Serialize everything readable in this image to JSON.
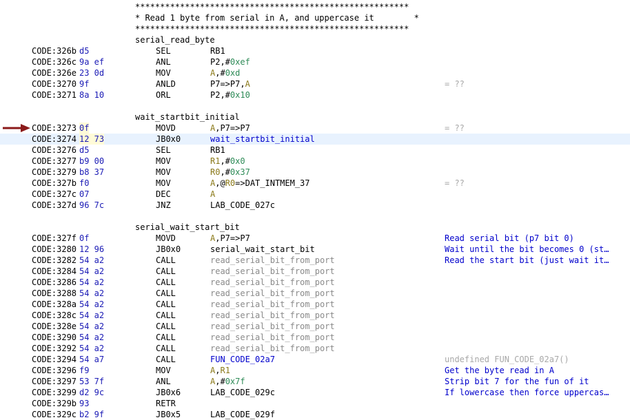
{
  "banner": [
    "*******************************************************",
    "* Read 1 byte from serial in A, and uppercase it        *",
    "*******************************************************"
  ],
  "label_serial_read_byte": "serial_read_byte",
  "label_wait_startbit_initial": "wait_startbit_initial",
  "label_serial_wait_start_bit": "serial_wait_start_bit",
  "block1": [
    {
      "addr": "CODE:326b",
      "bytes": "d5",
      "mnem": "SEL",
      "ops": [
        {
          "t": "RB1",
          "k": "plain"
        }
      ],
      "comment": ""
    },
    {
      "addr": "CODE:326c",
      "bytes": "9a ef",
      "mnem": "ANL",
      "ops": [
        {
          "t": "P2,#",
          "k": "plain"
        },
        {
          "t": "0xef",
          "k": "imm"
        }
      ],
      "comment": ""
    },
    {
      "addr": "CODE:326e",
      "bytes": "23 0d",
      "mnem": "MOV",
      "ops": [
        {
          "t": "A",
          "k": "reg"
        },
        {
          "t": ",#",
          "k": "plain"
        },
        {
          "t": "0xd",
          "k": "imm"
        }
      ],
      "comment": ""
    },
    {
      "addr": "CODE:3270",
      "bytes": "9f",
      "mnem": "ANLD",
      "ops": [
        {
          "t": "P7=>P7,",
          "k": "plain"
        },
        {
          "t": "A",
          "k": "reg"
        }
      ],
      "comment": "= ??",
      "ctype": "gray"
    },
    {
      "addr": "CODE:3271",
      "bytes": "8a 10",
      "mnem": "ORL",
      "ops": [
        {
          "t": "P2,#",
          "k": "plain"
        },
        {
          "t": "0x10",
          "k": "imm"
        }
      ],
      "comment": ""
    }
  ],
  "block2": [
    {
      "addr": "CODE:3273",
      "bytes": "0f",
      "mnem": "MOVD",
      "ops": [
        {
          "t": "A",
          "k": "reg"
        },
        {
          "t": ",P7=>P7",
          "k": "plain"
        }
      ],
      "comment": "= ??",
      "ctype": "gray",
      "ybytes": true
    },
    {
      "addr": "CODE:3274",
      "bytes": "12 73",
      "mnem": "JB0x0",
      "ops": [
        {
          "t": "wait_startbit_initial",
          "k": "lab"
        }
      ],
      "comment": "",
      "hl": true,
      "ybytes": true
    },
    {
      "addr": "CODE:3276",
      "bytes": "d5",
      "mnem": "SEL",
      "ops": [
        {
          "t": "RB1",
          "k": "plain"
        }
      ],
      "comment": ""
    },
    {
      "addr": "CODE:3277",
      "bytes": "b9 00",
      "mnem": "MOV",
      "ops": [
        {
          "t": "R1",
          "k": "reg"
        },
        {
          "t": ",#",
          "k": "plain"
        },
        {
          "t": "0x0",
          "k": "imm"
        }
      ],
      "comment": ""
    },
    {
      "addr": "CODE:3279",
      "bytes": "b8 37",
      "mnem": "MOV",
      "ops": [
        {
          "t": "R0",
          "k": "reg"
        },
        {
          "t": ",#",
          "k": "plain"
        },
        {
          "t": "0x37",
          "k": "imm"
        }
      ],
      "comment": ""
    },
    {
      "addr": "CODE:327b",
      "bytes": "f0",
      "mnem": "MOV",
      "ops": [
        {
          "t": "A",
          "k": "reg"
        },
        {
          "t": ",@",
          "k": "plain"
        },
        {
          "t": "R0",
          "k": "reg"
        },
        {
          "t": "=>DAT_INTMEM_37",
          "k": "plain"
        }
      ],
      "comment": "= ??",
      "ctype": "gray"
    },
    {
      "addr": "CODE:327c",
      "bytes": "07",
      "mnem": "DEC",
      "ops": [
        {
          "t": "A",
          "k": "reg"
        }
      ],
      "comment": ""
    },
    {
      "addr": "CODE:327d",
      "bytes": "96 7c",
      "mnem": "JNZ",
      "ops": [
        {
          "t": "LAB_CODE_027c",
          "k": "plain"
        }
      ],
      "comment": ""
    }
  ],
  "block3": [
    {
      "addr": "CODE:327f",
      "bytes": "0f",
      "mnem": "MOVD",
      "ops": [
        {
          "t": "A",
          "k": "reg"
        },
        {
          "t": ",P7=>P7",
          "k": "plain"
        }
      ],
      "comment": "Read serial bit (p7 bit 0)",
      "ctype": "blue"
    },
    {
      "addr": "CODE:3280",
      "bytes": "12 96",
      "mnem": "JB0x0",
      "ops": [
        {
          "t": "serial_wait_start_bit",
          "k": "plain"
        }
      ],
      "comment": "Wait until the bit becomes 0 (st…",
      "ctype": "blue"
    },
    {
      "addr": "CODE:3282",
      "bytes": "54 a2",
      "mnem": "CALL",
      "ops": [
        {
          "t": "read_serial_bit_from_port",
          "k": "call"
        }
      ],
      "comment": "Read the start bit (just wait it…",
      "ctype": "blue"
    },
    {
      "addr": "CODE:3284",
      "bytes": "54 a2",
      "mnem": "CALL",
      "ops": [
        {
          "t": "read_serial_bit_from_port",
          "k": "call"
        }
      ],
      "comment": ""
    },
    {
      "addr": "CODE:3286",
      "bytes": "54 a2",
      "mnem": "CALL",
      "ops": [
        {
          "t": "read_serial_bit_from_port",
          "k": "call"
        }
      ],
      "comment": ""
    },
    {
      "addr": "CODE:3288",
      "bytes": "54 a2",
      "mnem": "CALL",
      "ops": [
        {
          "t": "read_serial_bit_from_port",
          "k": "call"
        }
      ],
      "comment": ""
    },
    {
      "addr": "CODE:328a",
      "bytes": "54 a2",
      "mnem": "CALL",
      "ops": [
        {
          "t": "read_serial_bit_from_port",
          "k": "call"
        }
      ],
      "comment": ""
    },
    {
      "addr": "CODE:328c",
      "bytes": "54 a2",
      "mnem": "CALL",
      "ops": [
        {
          "t": "read_serial_bit_from_port",
          "k": "call"
        }
      ],
      "comment": ""
    },
    {
      "addr": "CODE:328e",
      "bytes": "54 a2",
      "mnem": "CALL",
      "ops": [
        {
          "t": "read_serial_bit_from_port",
          "k": "call"
        }
      ],
      "comment": ""
    },
    {
      "addr": "CODE:3290",
      "bytes": "54 a2",
      "mnem": "CALL",
      "ops": [
        {
          "t": "read_serial_bit_from_port",
          "k": "call"
        }
      ],
      "comment": ""
    },
    {
      "addr": "CODE:3292",
      "bytes": "54 a2",
      "mnem": "CALL",
      "ops": [
        {
          "t": "read_serial_bit_from_port",
          "k": "call"
        }
      ],
      "comment": ""
    },
    {
      "addr": "CODE:3294",
      "bytes": "54 a7",
      "mnem": "CALL",
      "ops": [
        {
          "t": "FUN_CODE_02a7",
          "k": "lab"
        }
      ],
      "comment": "undefined FUN_CODE_02a7()",
      "ctype": "gray"
    },
    {
      "addr": "CODE:3296",
      "bytes": "f9",
      "mnem": "MOV",
      "ops": [
        {
          "t": "A",
          "k": "reg"
        },
        {
          "t": ",",
          "k": "plain"
        },
        {
          "t": "R1",
          "k": "reg"
        }
      ],
      "comment": "Get the byte read in A",
      "ctype": "blue"
    },
    {
      "addr": "CODE:3297",
      "bytes": "53 7f",
      "mnem": "ANL",
      "ops": [
        {
          "t": "A",
          "k": "reg"
        },
        {
          "t": ",#",
          "k": "plain"
        },
        {
          "t": "0x7f",
          "k": "imm"
        }
      ],
      "comment": "Strip bit 7 for the fun of it",
      "ctype": "blue"
    },
    {
      "addr": "CODE:3299",
      "bytes": "d2 9c",
      "mnem": "JB0x6",
      "ops": [
        {
          "t": "LAB_CODE_029c",
          "k": "plain"
        }
      ],
      "comment": "If lowercase then force uppercas…",
      "ctype": "blue"
    },
    {
      "addr": "CODE:329b",
      "bytes": "93",
      "mnem": "RETR",
      "ops": [],
      "comment": ""
    }
  ],
  "cutoff_row": {
    "addr": "CODE:329c",
    "bytes": "b2 9f",
    "mnem": "JB0x5",
    "ops": [
      {
        "t": "LAB_CODE_029f",
        "k": "plain"
      }
    ],
    "comment": ""
  },
  "current_address_arrow": "arrow-icon"
}
